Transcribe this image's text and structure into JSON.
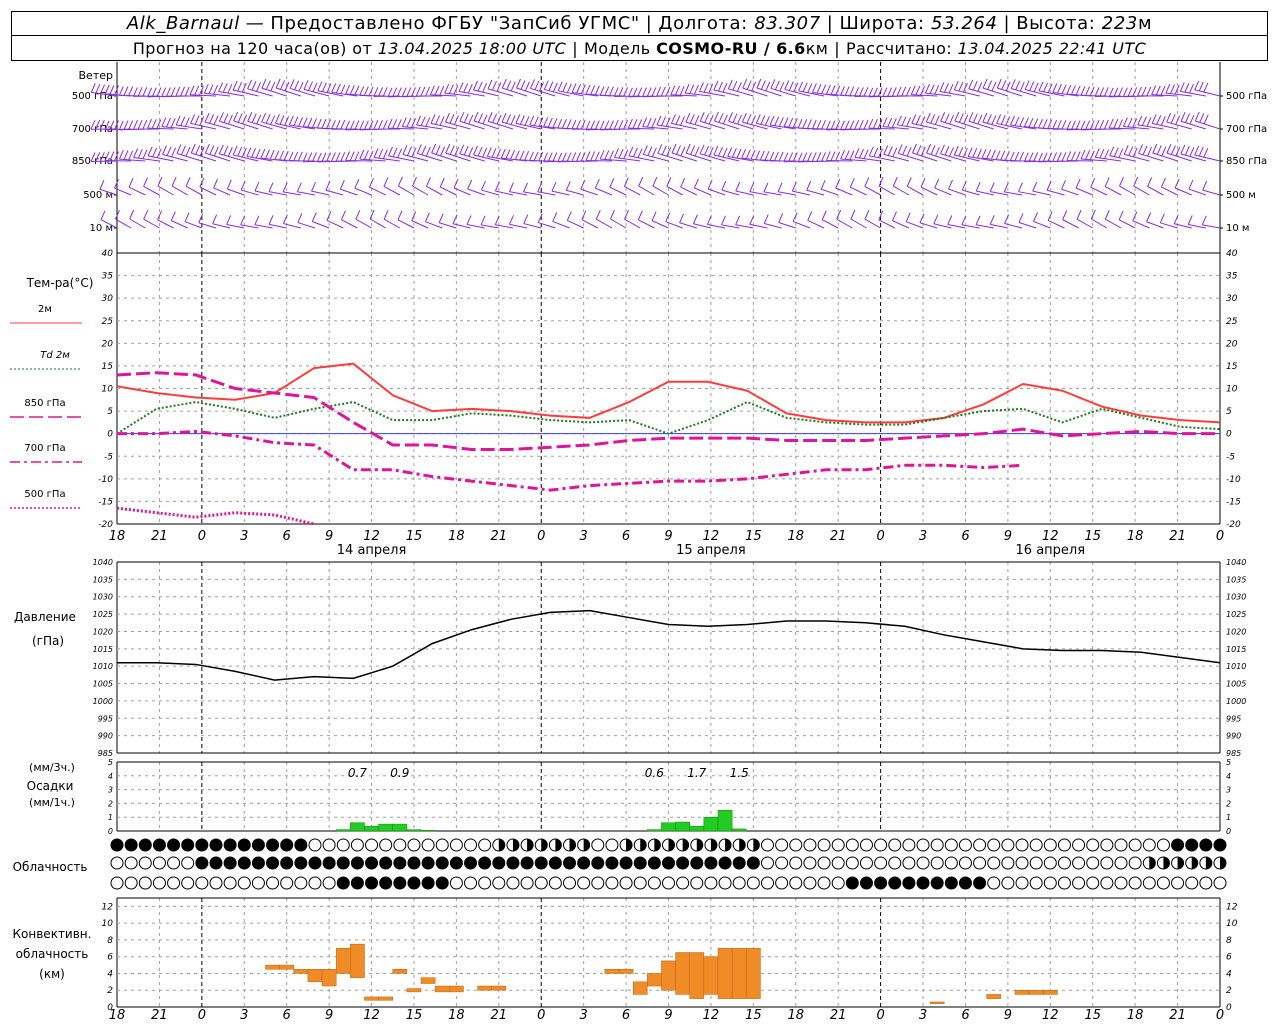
{
  "header": {
    "station": "Alk_Barnaul",
    "dash": "—",
    "provided_by": "Предоставлено ФГБУ \"ЗапСиб УГМС\"",
    "lon_label": "Долгота:",
    "lon": "83.307",
    "lat_label": "Широта:",
    "lat": "53.264",
    "alt_label": "Высота:",
    "alt": "223",
    "alt_unit": "м",
    "forecast_prefix": "Прогноз на 120 часа(ов) от",
    "forecast_time": "13.04.2025 18:00 UTC",
    "model_label": "Модель",
    "model_name": "COSMO-RU / 6.6",
    "model_unit": "км",
    "calc_label": "Рассчитано:",
    "calc_time": "13.04.2025 22:41 UTC"
  },
  "colors": {
    "wind": "#8a2be2",
    "t2m": "#ff3c3c",
    "td2m": "#1e7a1e",
    "t850": "#e0149a",
    "pressure": "#000000",
    "precip": "#22cc22",
    "conv": "#f08c28",
    "zero_line": "#3a3aff",
    "grid": "#a0a0a0"
  },
  "time_axis": {
    "hours_from_start": [
      0,
      3,
      6,
      9,
      12,
      15,
      18,
      21,
      24,
      27,
      30,
      33,
      36,
      39,
      42,
      45,
      48,
      51,
      54,
      57,
      60,
      63,
      66,
      69,
      72,
      75,
      78
    ],
    "tick_labels": [
      "18",
      "21",
      "0",
      "3",
      "6",
      "9",
      "12",
      "15",
      "18",
      "21",
      "0",
      "3",
      "6",
      "9",
      "12",
      "15",
      "18",
      "21",
      "0",
      "3",
      "6",
      "9",
      "12",
      "15",
      "18",
      "21",
      "0"
    ],
    "day_boundaries": [
      6,
      30,
      54
    ],
    "day_labels": [
      {
        "hour": 18,
        "text": "14 апреля"
      },
      {
        "hour": 42,
        "text": "15 апреля"
      },
      {
        "hour": 66,
        "text": "16 апреля"
      }
    ]
  },
  "wind_panel": {
    "title": "Ветер",
    "levels": [
      "500 гПа",
      "700 гПа",
      "850 гПа",
      "500 м",
      "10 м"
    ]
  },
  "chart_data": [
    {
      "type": "line",
      "title": "Тем-ра(°C)",
      "ylim": [
        -20,
        40
      ],
      "yticks": [
        -20,
        -15,
        -10,
        -5,
        0,
        5,
        10,
        15,
        20,
        25,
        30,
        35,
        40
      ],
      "x": [
        0,
        3,
        6,
        9,
        12,
        15,
        18,
        21,
        24,
        27,
        30,
        33,
        36,
        39,
        42,
        45,
        48,
        51,
        54,
        57,
        60,
        63,
        66,
        69,
        72,
        75,
        78
      ],
      "series": [
        {
          "name": "2м",
          "style": "solid",
          "values": [
            10.5,
            9,
            8,
            7.5,
            9,
            14.5,
            15.5,
            8.5,
            5,
            5.5,
            5,
            4,
            3.5,
            7,
            11.5,
            11.5,
            9.5,
            4.5,
            3,
            2.5,
            2.5,
            3.5,
            6.5,
            11,
            9.5,
            6,
            4,
            3,
            2.5
          ]
        },
        {
          "name": "Td 2м",
          "style": "dotted",
          "values": [
            0,
            5.5,
            7,
            5.5,
            3.5,
            5.5,
            7,
            3,
            3,
            4.5,
            4,
            3,
            2.5,
            3,
            0,
            3,
            7,
            3.5,
            2.5,
            2,
            2,
            3.5,
            5,
            5.5,
            2.5,
            5.5,
            3.5,
            1.5,
            1
          ]
        },
        {
          "name": "850 гПа",
          "style": "longdash",
          "values": [
            13,
            13.5,
            13,
            10,
            9,
            8,
            2.5,
            -2.5,
            -2.5,
            -3.5,
            -3.5,
            -3,
            -2.5,
            -1.5,
            -1,
            -1,
            -1,
            -1.5,
            -1.5,
            -1.5,
            -1,
            -0.5,
            0,
            1,
            -0.5,
            0,
            0.5,
            0,
            0
          ]
        },
        {
          "name": "700 гПа",
          "style": "dashdot",
          "values": [
            0,
            0,
            0.5,
            -0.5,
            -2,
            -2.5,
            -8,
            -8,
            -9.5,
            -10.5,
            -11.5,
            -12.5,
            -11.5,
            -11,
            -10.5,
            -10.5,
            -10,
            -9,
            -8,
            -8,
            -7,
            -7,
            -7.5,
            -7
          ]
        },
        {
          "name": "500 гПа",
          "style": "shortdot",
          "values": [
            -16.5,
            -17.5,
            -18.5,
            -17.5,
            -18,
            -20
          ]
        }
      ]
    },
    {
      "type": "line",
      "title": "Давление",
      "ylabel": "(гПа)",
      "ylim": [
        985,
        1040
      ],
      "yticks": [
        985,
        990,
        995,
        1000,
        1005,
        1010,
        1015,
        1020,
        1025,
        1030,
        1035,
        1040
      ],
      "x": [
        0,
        3,
        6,
        9,
        12,
        15,
        18,
        21,
        24,
        27,
        30,
        33,
        36,
        39,
        42,
        45,
        48,
        51,
        54,
        57,
        60,
        63,
        66,
        69,
        72,
        75,
        78
      ],
      "series": [
        {
          "name": "",
          "values": [
            1011,
            1011,
            1010.5,
            1008.5,
            1006,
            1007,
            1006.5,
            1010,
            1016.5,
            1020.5,
            1023.5,
            1025.5,
            1026,
            1024,
            1022,
            1021.5,
            1022,
            1023,
            1023,
            1022.5,
            1021.5,
            1019,
            1017,
            1015,
            1014.5,
            1014.5,
            1014,
            1012.5,
            1011
          ]
        }
      ]
    },
    {
      "type": "bar",
      "title": "Осадки",
      "ylabel_top": "(мм/3ч.)",
      "ylabel_bottom": "(мм/1ч.)",
      "ylim": [
        0,
        5
      ],
      "yticks": [
        0,
        1,
        2,
        3,
        4,
        5
      ],
      "bars": [
        {
          "hour": 16,
          "value": 0.1
        },
        {
          "hour": 17,
          "value": 0.6
        },
        {
          "hour": 18,
          "value": 0.35
        },
        {
          "hour": 19,
          "value": 0.5
        },
        {
          "hour": 20,
          "value": 0.5
        },
        {
          "hour": 21,
          "value": 0.1
        },
        {
          "hour": 22,
          "value": 0.05
        },
        {
          "hour": 38,
          "value": 0.1
        },
        {
          "hour": 39,
          "value": 0.6
        },
        {
          "hour": 40,
          "value": 0.65
        },
        {
          "hour": 41,
          "value": 0.35
        },
        {
          "hour": 42,
          "value": 1.0
        },
        {
          "hour": 43,
          "value": 1.5
        },
        {
          "hour": 44,
          "value": 0.15
        }
      ],
      "annotations": [
        {
          "hour": 17,
          "text": "0.7"
        },
        {
          "hour": 20,
          "text": "0.9"
        },
        {
          "hour": 38,
          "text": "0.6"
        },
        {
          "hour": 41,
          "text": "1.7"
        },
        {
          "hour": 44,
          "text": "1.5"
        }
      ]
    },
    {
      "type": "bar",
      "title": "Конвективн. облачность",
      "ylabel": "(км)",
      "ylim": [
        0,
        13
      ],
      "yticks": [
        0,
        2,
        4,
        6,
        8,
        10,
        12
      ],
      "segments": [
        {
          "hour": 11,
          "bottom": 4.5,
          "top": 5.0
        },
        {
          "hour": 12,
          "bottom": 4.5,
          "top": 5.0
        },
        {
          "hour": 13,
          "bottom": 4.0,
          "top": 4.5
        },
        {
          "hour": 14,
          "bottom": 3.0,
          "top": 4.5
        },
        {
          "hour": 15,
          "bottom": 2.5,
          "top": 4.5
        },
        {
          "hour": 16,
          "bottom": 4.0,
          "top": 7.0
        },
        {
          "hour": 17,
          "bottom": 3.5,
          "top": 7.5
        },
        {
          "hour": 18,
          "bottom": 0.8,
          "top": 1.2
        },
        {
          "hour": 19,
          "bottom": 0.8,
          "top": 1.2
        },
        {
          "hour": 20,
          "bottom": 4.0,
          "top": 4.5
        },
        {
          "hour": 21,
          "bottom": 1.8,
          "top": 2.2
        },
        {
          "hour": 22,
          "bottom": 2.8,
          "top": 3.5
        },
        {
          "hour": 23,
          "bottom": 1.8,
          "top": 2.5
        },
        {
          "hour": 24,
          "bottom": 1.8,
          "top": 2.5
        },
        {
          "hour": 26,
          "bottom": 2.0,
          "top": 2.5
        },
        {
          "hour": 27,
          "bottom": 2.0,
          "top": 2.5
        },
        {
          "hour": 35,
          "bottom": 4.0,
          "top": 4.5
        },
        {
          "hour": 36,
          "bottom": 4.0,
          "top": 4.5
        },
        {
          "hour": 37,
          "bottom": 1.5,
          "top": 3.0
        },
        {
          "hour": 38,
          "bottom": 2.5,
          "top": 4.0
        },
        {
          "hour": 39,
          "bottom": 2.0,
          "top": 5.5
        },
        {
          "hour": 40,
          "bottom": 1.5,
          "top": 6.5
        },
        {
          "hour": 41,
          "bottom": 1.0,
          "top": 6.5
        },
        {
          "hour": 42,
          "bottom": 1.5,
          "top": 6.0
        },
        {
          "hour": 43,
          "bottom": 1.0,
          "top": 7.0
        },
        {
          "hour": 44,
          "bottom": 1.0,
          "top": 7.0
        },
        {
          "hour": 45,
          "bottom": 1.0,
          "top": 7.0
        },
        {
          "hour": 58,
          "bottom": 0.4,
          "top": 0.6
        },
        {
          "hour": 62,
          "bottom": 1.0,
          "top": 1.5
        },
        {
          "hour": 64,
          "bottom": 1.5,
          "top": 2.0
        },
        {
          "hour": 65,
          "bottom": 1.5,
          "top": 2.0
        },
        {
          "hour": 66,
          "bottom": 1.5,
          "top": 2.0
        }
      ]
    }
  ],
  "temperature_legend": [
    {
      "label": "2м",
      "style": "solid"
    },
    {
      "label": "Td  2м",
      "style": "dotted"
    },
    {
      "label": "850 гПа",
      "style": "longdash"
    },
    {
      "label": "700 гПа",
      "style": "dashdot"
    },
    {
      "label": "500 гПа",
      "style": "shortdot"
    }
  ],
  "cloud_panel": {
    "title": "Облачность",
    "rows": 3
  }
}
